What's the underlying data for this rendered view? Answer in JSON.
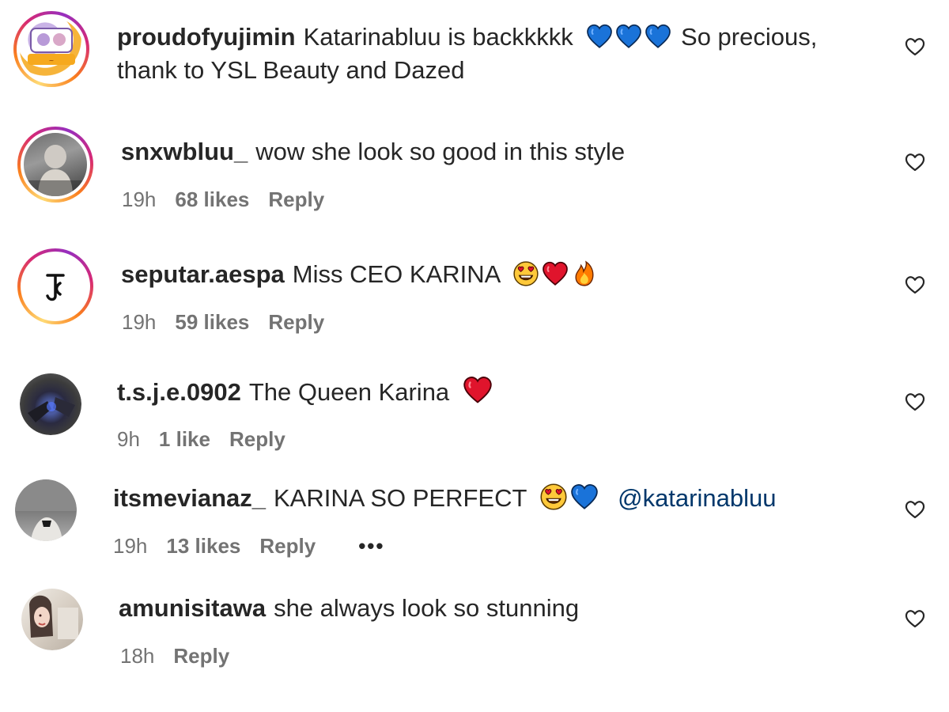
{
  "comments": [
    {
      "username": "proudofyujimin",
      "text": "Katarinabluu is backkkkk",
      "emojis": [
        "blue-heart",
        "blue-heart",
        "blue-heart"
      ],
      "text_after": "So precious, thank to YSL Beauty and Dazed",
      "time": "",
      "likes": "",
      "reply": ""
    },
    {
      "username": "snxwbluu_",
      "text": "wow she look so good in this style",
      "time": "19h",
      "likes": "68 likes",
      "reply": "Reply"
    },
    {
      "username": "seputar.aespa",
      "text": "Miss CEO KARINA",
      "emojis": [
        "heart-eyes",
        "red-heart",
        "fire"
      ],
      "time": "19h",
      "likes": "59 likes",
      "reply": "Reply"
    },
    {
      "username": "t.s.j.e.0902",
      "text": "The Queen Karina",
      "emojis": [
        "red-heart"
      ],
      "time": "9h",
      "likes": "1 like",
      "reply": "Reply"
    },
    {
      "username": "itsmevianaz_",
      "text": "KARINA SO PERFECT",
      "emojis": [
        "heart-eyes",
        "blue-heart"
      ],
      "mention": "@katarinabluu",
      "time": "19h",
      "likes": "13 likes",
      "reply": "Reply",
      "more": "•••"
    },
    {
      "username": "amunisitawa",
      "text": "she always look so stunning",
      "time": "18h",
      "likes": "",
      "reply": "Reply"
    }
  ],
  "icons": {
    "like": "heart-outline-icon",
    "more": "more-options-icon"
  },
  "colors": {
    "text": "#262626",
    "meta": "#737373",
    "mention": "#00376b",
    "blue_heart": "#1a73d9",
    "red_heart": "#e0142c"
  }
}
